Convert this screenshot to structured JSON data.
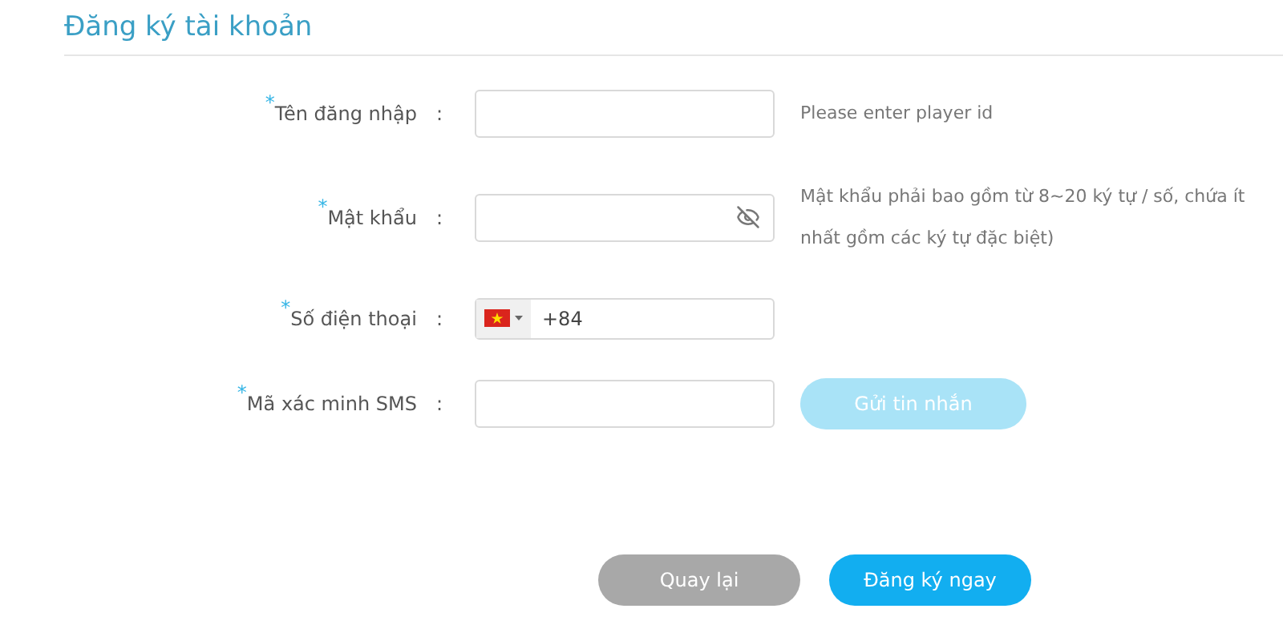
{
  "title": "Đăng ký tài khoản",
  "fields": [
    {
      "kind": "text",
      "required_mark": "*",
      "label": "Tên đăng nhập",
      "colon": ":",
      "hint": "Please enter player id"
    },
    {
      "kind": "password",
      "required_mark": "*",
      "label": "Mật khẩu",
      "colon": ":",
      "hint": "Mật khẩu phải bao gồm từ 8~20 ký tự / số, chứa ít nhất gồm các ký tự đặc biệt)"
    },
    {
      "kind": "phone",
      "required_mark": "*",
      "label": "Số điện thoại",
      "colon": ":",
      "value": "+84"
    },
    {
      "kind": "sms",
      "required_mark": "*",
      "label": "Mã xác minh SMS",
      "colon": ":",
      "button": {
        "label": "Gửi tin nhắn",
        "disabled": true
      }
    }
  ],
  "buttons": [
    {
      "label": "Quay lại",
      "kind": "back"
    },
    {
      "label": "Đăng ký ngay",
      "kind": "primary"
    }
  ]
}
